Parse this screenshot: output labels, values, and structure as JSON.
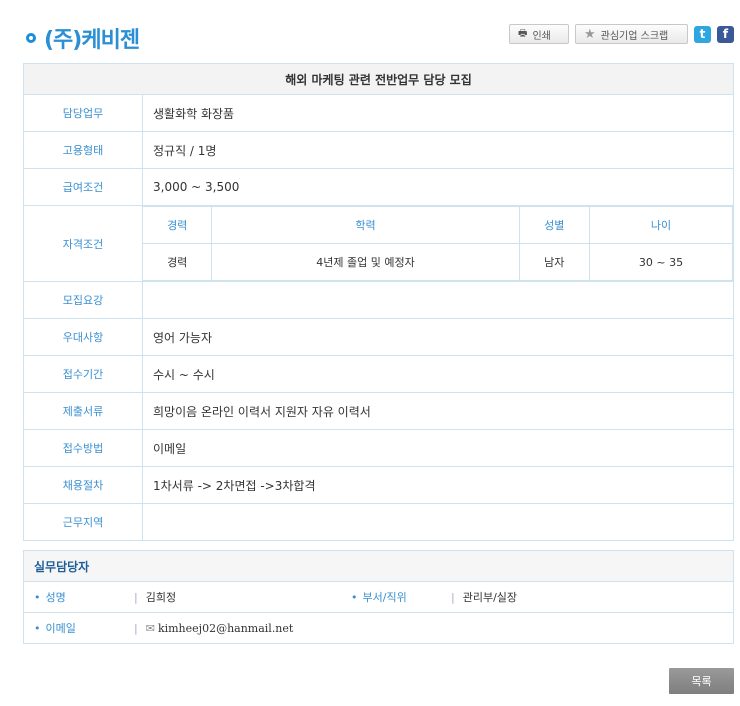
{
  "company": {
    "name": "(주)케비젠"
  },
  "toolbar": {
    "print_label": "인쇄",
    "scrap_label": "관심기업 스크랩",
    "twitter": "t",
    "facebook": "f"
  },
  "posting": {
    "title": "해외 마케팅 관련 전반업무 담당 모집",
    "rows": [
      {
        "label": "담당업무",
        "value": "생활화학 화장품"
      },
      {
        "label": "고용형태",
        "value": "정규직 / 1명"
      },
      {
        "label": "급여조건",
        "value": "3,000 ~ 3,500"
      }
    ],
    "qualification": {
      "label": "자격조건",
      "headers": [
        "경력",
        "학력",
        "성별",
        "나이"
      ],
      "values": [
        "경력",
        "4년제 졸업 및 예정자",
        "남자",
        "30 ~ 35"
      ]
    },
    "rows2": [
      {
        "label": "모집요강",
        "value": ""
      },
      {
        "label": "우대사항",
        "value": "영어 가능자"
      },
      {
        "label": "접수기간",
        "value": "수시 ~ 수시"
      },
      {
        "label": "제출서류",
        "value": "희망이음 온라인 이력서 지원자 자유 이력서"
      },
      {
        "label": "접수방법",
        "value": "이메일"
      },
      {
        "label": "채용절차",
        "value": "1차서류 -> 2차면접 ->3차합격"
      },
      {
        "label": "근무지역",
        "value": ""
      }
    ]
  },
  "contact": {
    "title": "실무담당자",
    "name_label": "성명",
    "name_value": "김희정",
    "dept_label": "부서/직위",
    "dept_value": "관리부/실장",
    "email_label": "이메일",
    "email_value": "kimheej02@hanmail.net"
  },
  "list_button": "목록",
  "colors": {
    "accent": "#2a8fd4",
    "border": "#cfe3ee"
  }
}
